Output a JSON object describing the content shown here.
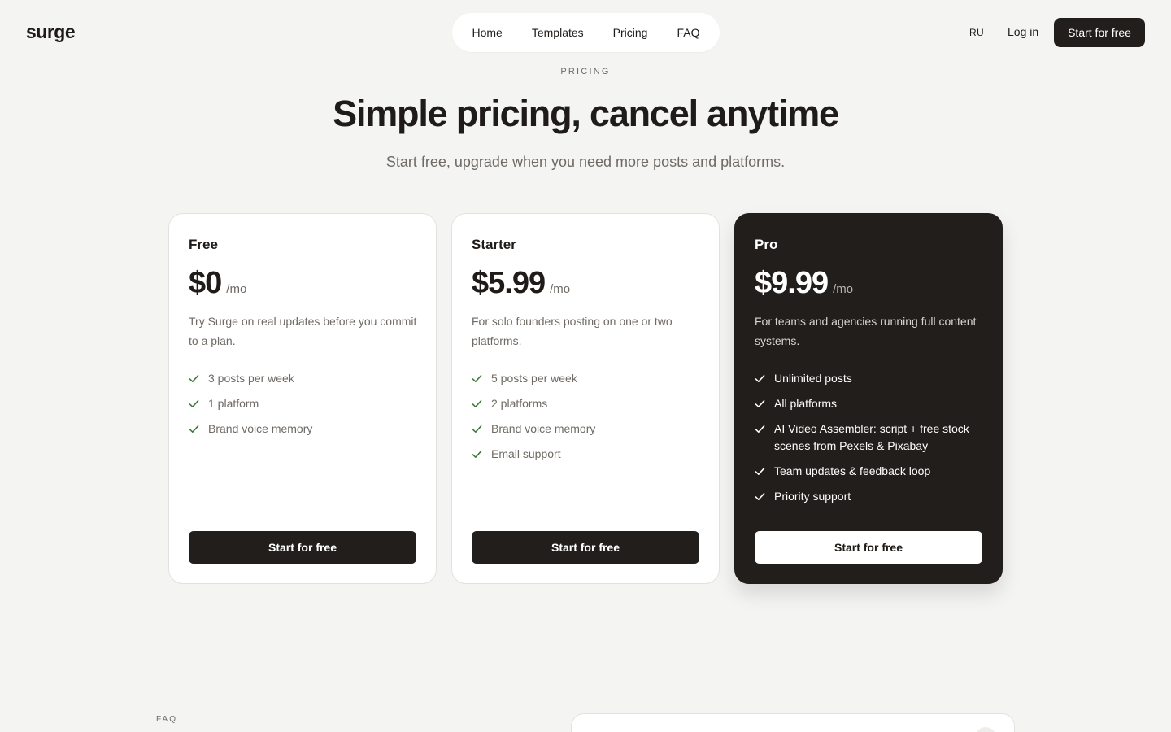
{
  "header": {
    "logo": "surge",
    "nav": [
      "Home",
      "Templates",
      "Pricing",
      "FAQ"
    ],
    "lang": "RU",
    "login": "Log in",
    "cta": "Start for free"
  },
  "hero": {
    "eyebrow": "PRICING",
    "title": "Simple pricing, cancel anytime",
    "subtitle": "Start free, upgrade when you need more posts and platforms."
  },
  "plans": [
    {
      "name": "Free",
      "price": "$0",
      "period": "/mo",
      "description": "Try Surge on real updates before you commit to a plan.",
      "features": [
        "3 posts per week",
        "1 platform",
        "Brand voice memory"
      ],
      "button": "Start for free"
    },
    {
      "name": "Starter",
      "price": "$5.99",
      "period": "/mo",
      "description": "For solo founders posting on one or two platforms.",
      "features": [
        "5 posts per week",
        "2 platforms",
        "Brand voice memory",
        "Email support"
      ],
      "button": "Start for free"
    },
    {
      "name": "Pro",
      "price": "$9.99",
      "period": "/mo",
      "description": "For teams and agencies running full content systems.",
      "features": [
        "Unlimited posts",
        "All platforms",
        "AI Video Assembler: script + free stock scenes from Pexels & Pixabay",
        "Team updates & feedback loop",
        "Priority support"
      ],
      "button": "Start for free"
    }
  ],
  "faq": {
    "eyebrow": "FAQ"
  },
  "colors": {
    "background": "#f4f4f3",
    "dark": "#221e1b",
    "check_green": "#3d7a3a",
    "muted_text": "#6f6a64"
  },
  "icons": {
    "feature": "check-icon"
  }
}
